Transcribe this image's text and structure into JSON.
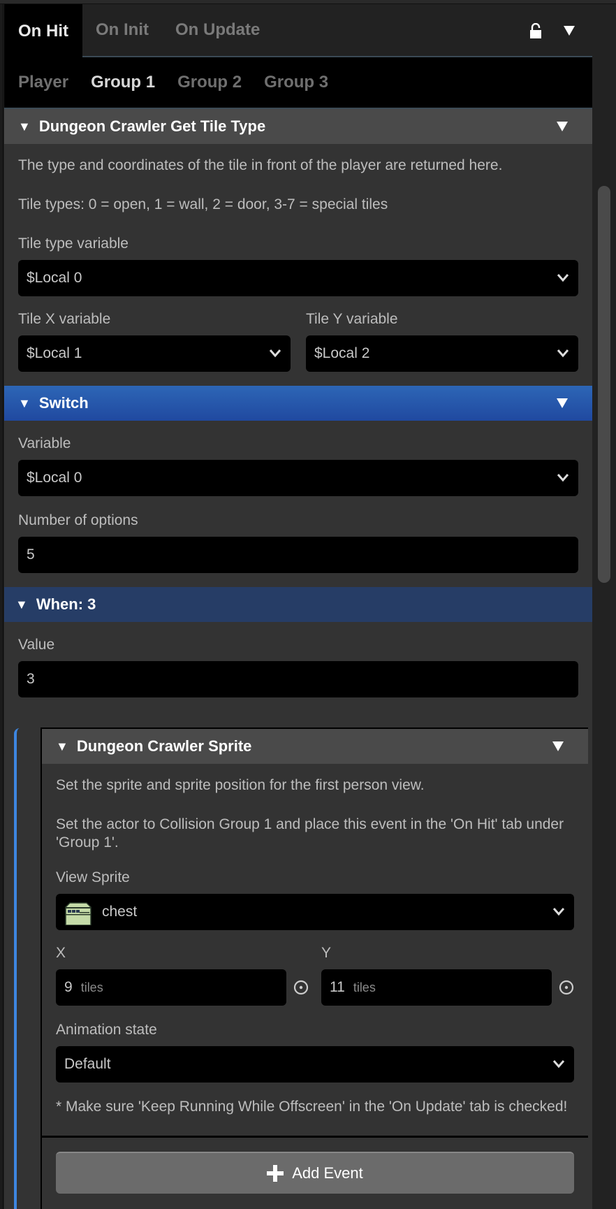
{
  "tabs": [
    {
      "label": "On Hit",
      "active": true
    },
    {
      "label": "On Init",
      "active": false
    },
    {
      "label": "On Update",
      "active": false
    }
  ],
  "tab_actions": {
    "lock_icon": "unlock-icon",
    "menu_icon": "triangle-down-icon"
  },
  "subtabs": [
    {
      "label": "Player",
      "active": false
    },
    {
      "label": "Group 1",
      "active": true
    },
    {
      "label": "Group 2",
      "active": false
    },
    {
      "label": "Group 3",
      "active": false
    }
  ],
  "get_tile_type": {
    "title": "Dungeon Crawler Get Tile Type",
    "description1": "The type and coordinates of the tile in front of the player are returned here.",
    "description2": "Tile types: 0 = open, 1 = wall, 2 = door, 3-7 = special tiles",
    "tile_type_label": "Tile type variable",
    "tile_type_value": "$Local 0",
    "tile_x_label": "Tile X variable",
    "tile_x_value": "$Local 1",
    "tile_y_label": "Tile Y variable",
    "tile_y_value": "$Local 2"
  },
  "switch": {
    "title": "Switch",
    "variable_label": "Variable",
    "variable_value": "$Local 0",
    "options_label": "Number of options",
    "options_value": "5",
    "accent": "#2d66b6"
  },
  "when": {
    "title": "When: 3",
    "value_label": "Value",
    "value": "3",
    "accent": "#263d66"
  },
  "sprite_event": {
    "title": "Dungeon Crawler Sprite",
    "description1": "Set the sprite and sprite position for the first person view.",
    "description2": "Set the actor to Collision Group 1 and place this event in the 'On Hit' tab under 'Group 1'.",
    "view_sprite_label": "View Sprite",
    "view_sprite_value": "chest",
    "x_label": "X",
    "x_value": "9",
    "y_label": "Y",
    "y_value": "11",
    "unit": "tiles",
    "animation_label": "Animation state",
    "animation_value": "Default",
    "note": "* Make sure 'Keep Running While Offscreen' in the 'On Update' tab is checked!"
  },
  "add_event": {
    "label": "Add Event"
  }
}
